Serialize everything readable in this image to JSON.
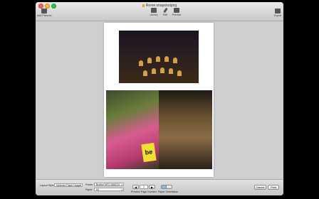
{
  "window": {
    "title": "Rome.snapshotproj"
  },
  "toolbar": {
    "add_pictures": "Add Pictures",
    "library": "Library",
    "edit": "Edit",
    "preview": "Preview",
    "export": "Export"
  },
  "print_settings": {
    "layout_style_label": "Layout Style",
    "layout_style_value": "Minimize Paper Usage",
    "printer_label": "Printer",
    "printer_value": "Brother MFC-9450CN",
    "paper_label": "Paper",
    "paper_value": "A4",
    "preview_page_value": "1",
    "preview_page_label": "Preview Page Number",
    "paper_orientation_label": "Paper Orientation",
    "cancel_label": "Cancel",
    "print_label": "Print"
  },
  "preview": {
    "sign_text": "be"
  },
  "colors": {
    "close": "#ff5f57",
    "minimize": "#febc2e",
    "zoom": "#28c840",
    "orientation_selected": "#8ab4e8"
  }
}
